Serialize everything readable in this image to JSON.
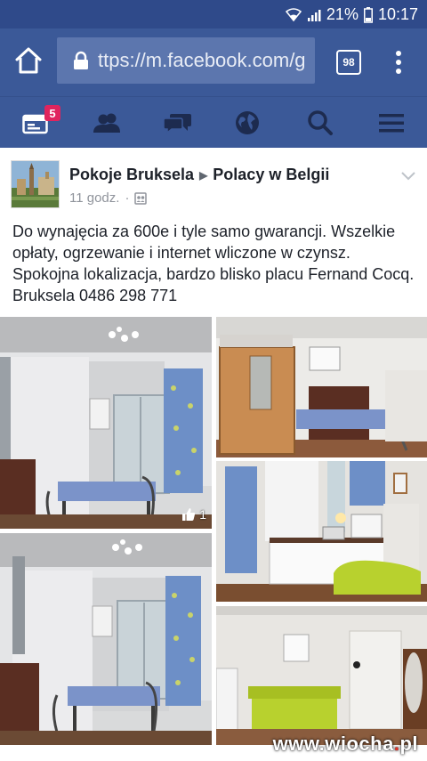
{
  "status_bar": {
    "battery": "21%",
    "time": "10:17"
  },
  "browser": {
    "url": "ttps://m.facebook.com/g",
    "tab_count": "98",
    "icons": [
      "home-icon",
      "lock-icon",
      "tabs-icon",
      "overflow-menu-icon"
    ]
  },
  "fb_nav": {
    "notifications_badge": "5",
    "icons": [
      "news-feed-icon",
      "friends-icon",
      "messages-icon",
      "globe-icon",
      "search-icon",
      "menu-icon"
    ]
  },
  "post": {
    "page_name": "Pokoje Bruksela",
    "group_name": "Polacy w Belgii",
    "time": "11 godz.",
    "separator": "·",
    "text": "Do wynajęcia za 600e i tyle samo gwarancji. Wszelkie opłaty, ogrzewanie i internet wliczone w czynsz. Spokojna lokalizacja, bardzo blisko placu Fernand Cocq. Bruksela 0486 298 771",
    "photo_likes": "1"
  },
  "watermark": {
    "prefix": "www.wiocha",
    "dot": ".",
    "suffix": "pl"
  },
  "colors": {
    "facebook_blue": "#3b5998",
    "status_bar": "#2f4a8a",
    "badge_red": "#e0245e"
  }
}
